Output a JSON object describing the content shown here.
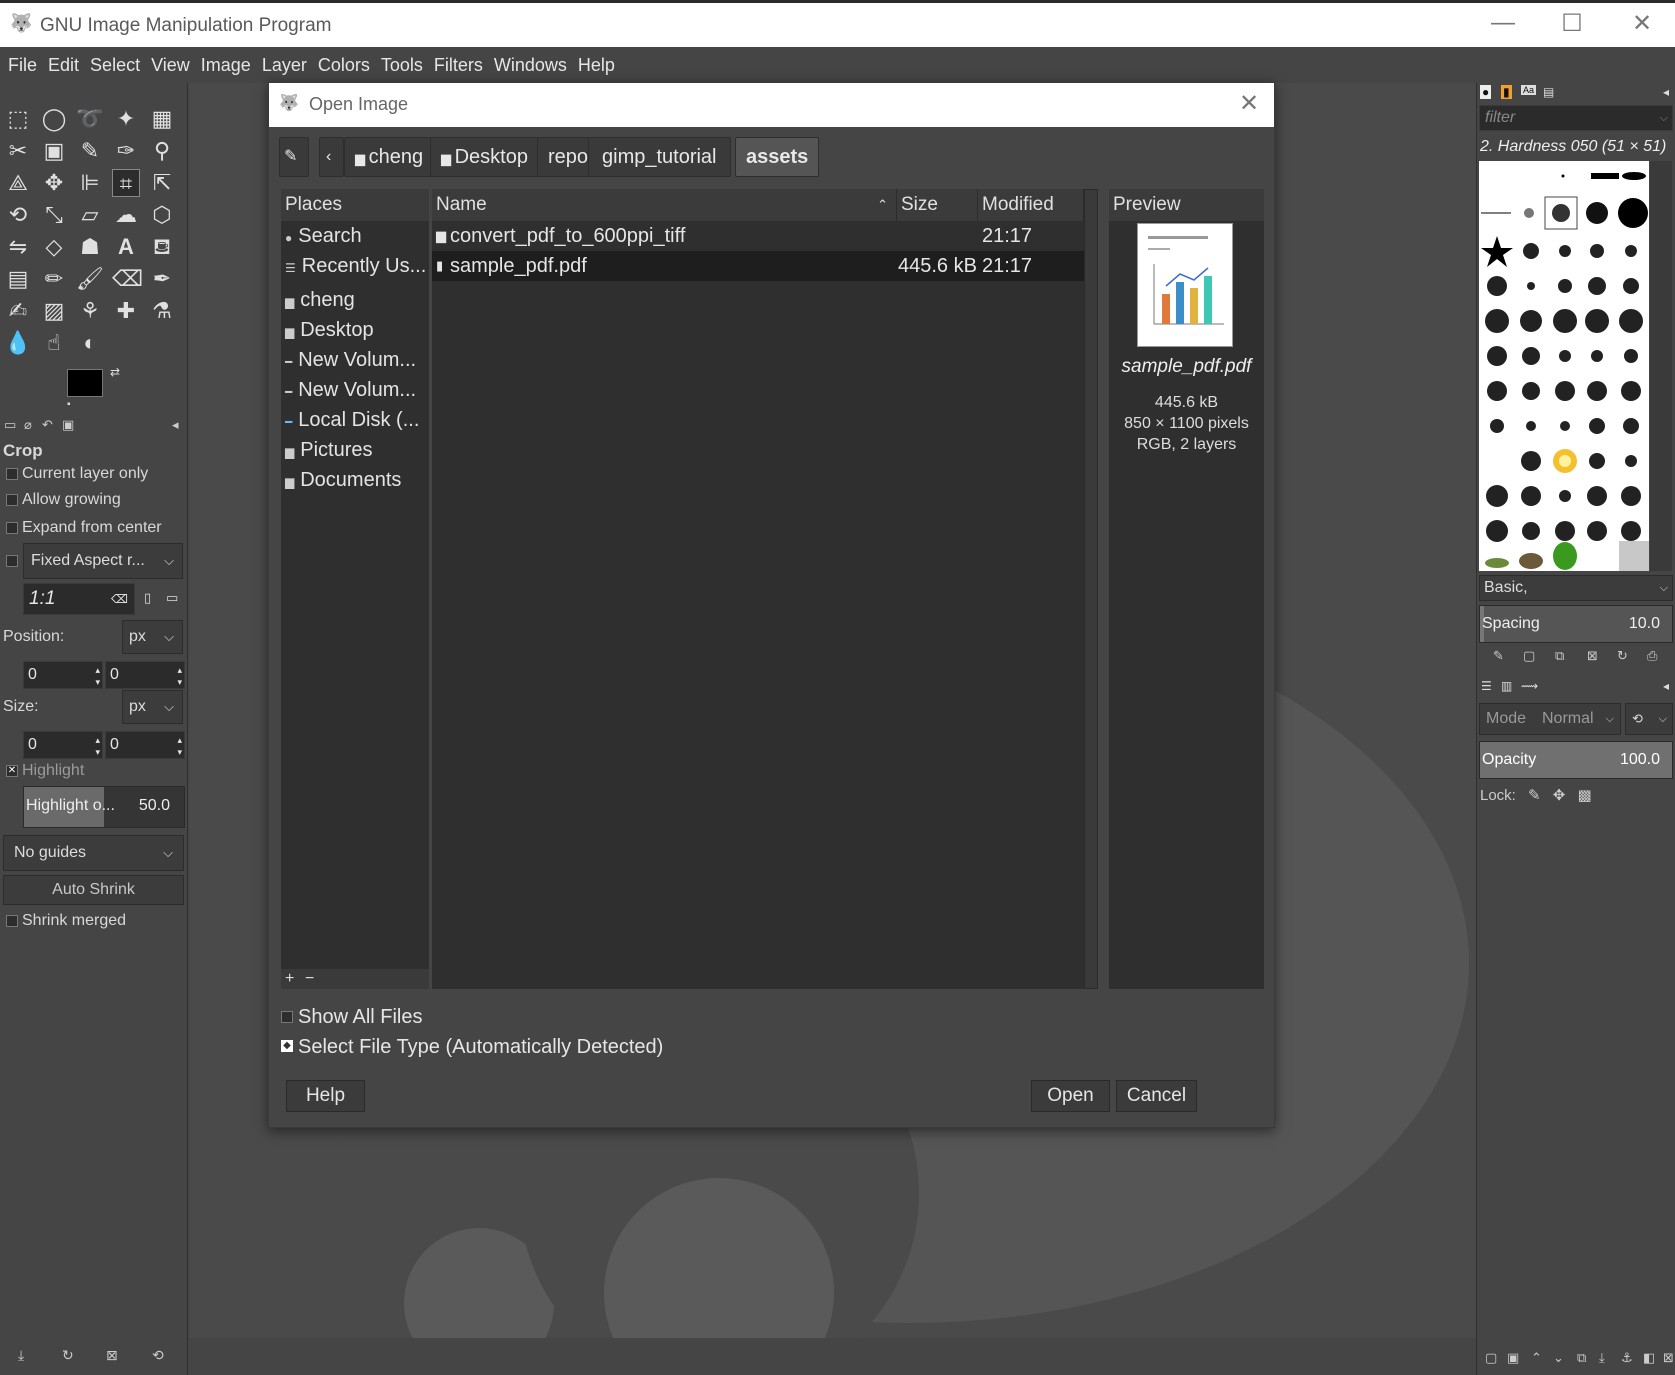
{
  "window": {
    "title": "GNU Image Manipulation Program",
    "minimize": "—",
    "maximize": "☐",
    "close": "✕"
  },
  "menu": [
    "File",
    "Edit",
    "Select",
    "View",
    "Image",
    "Layer",
    "Colors",
    "Tools",
    "Filters",
    "Windows",
    "Help"
  ],
  "tool_options": {
    "title": "Crop",
    "current_layer_only": "Current layer only",
    "allow_growing": "Allow growing",
    "expand_from_center": "Expand from center",
    "fixed_aspect": "Fixed Aspect r...",
    "ratio": "1:1",
    "position_label": "Position:",
    "position_unit": "px",
    "position_x": "0",
    "position_y": "0",
    "size_label": "Size:",
    "size_unit": "px",
    "size_x": "0",
    "size_y": "0",
    "highlight": "Highlight",
    "highlight_opacity_label": "Highlight o...",
    "highlight_opacity_value": "50.0",
    "guides": "No guides",
    "auto_shrink": "Auto Shrink",
    "shrink_merged": "Shrink merged"
  },
  "dialog": {
    "title": "Open Image",
    "breadcrumbs": [
      "cheng",
      "Desktop",
      "repo",
      "gimp_tutorial",
      "assets"
    ],
    "places_header": "Places",
    "places": [
      "Search",
      "Recently Us...",
      "cheng",
      "Desktop",
      "New Volum...",
      "New Volum...",
      "Local Disk (...",
      "Pictures",
      "Documents"
    ],
    "columns": {
      "name": "Name",
      "size": "Size",
      "modified": "Modified"
    },
    "files": [
      {
        "name": "convert_pdf_to_600ppi_tiff",
        "size": "",
        "modified": "21:17",
        "type": "folder"
      },
      {
        "name": "sample_pdf.pdf",
        "size": "445.6 kB",
        "modified": "21:17",
        "type": "file"
      }
    ],
    "preview": {
      "header": "Preview",
      "filename": "sample_pdf.pdf",
      "size": "445.6 kB",
      "dimensions": "850 × 1100 pixels",
      "info": "RGB, 2 layers"
    },
    "show_all_files": "Show All Files",
    "select_file_type": "Select File Type (Automatically Detected)",
    "help_button": "Help",
    "open_button": "Open",
    "cancel_button": "Cancel"
  },
  "brushes": {
    "filter_placeholder": "filter",
    "current_brush": "2. Hardness 050 (51 × 51)",
    "tag": "Basic,",
    "spacing_label": "Spacing",
    "spacing_value": "10.0"
  },
  "layers": {
    "mode_label": "Mode",
    "mode_value": "Normal",
    "opacity_label": "Opacity",
    "opacity_value": "100.0",
    "lock_label": "Lock:"
  }
}
